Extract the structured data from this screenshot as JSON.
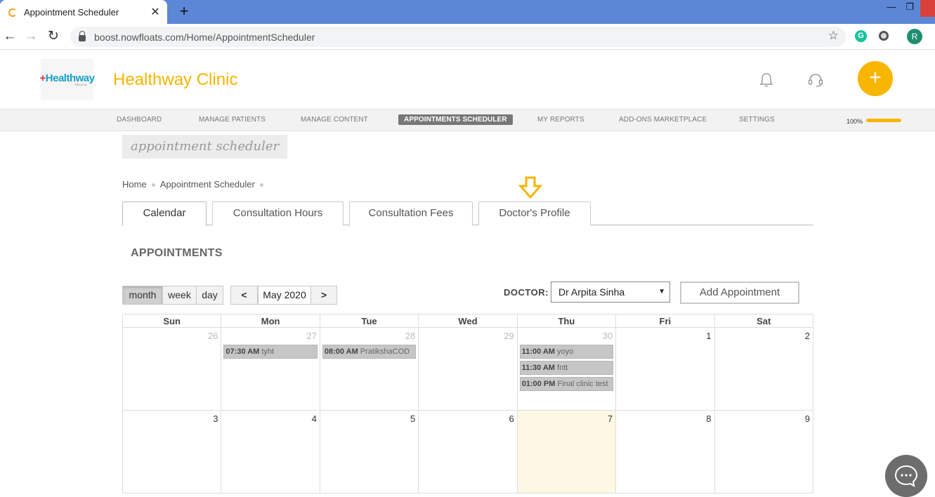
{
  "browser": {
    "tab_title": "Appointment Scheduler",
    "tab_close": "✕",
    "new_tab": "+",
    "url": "boost.nowfloats.com/Home/AppointmentScheduler",
    "avatar_letter": "R",
    "ext_letter": "G"
  },
  "header": {
    "logo_plus": "+",
    "logo_text": "Healthway",
    "logo_sub": "MEDICAL",
    "clinic_name": "Healthway Clinic",
    "fab_label": "+"
  },
  "nav": {
    "items": [
      "DASHBOARD",
      "MANAGE PATIENTS",
      "MANAGE CONTENT",
      "APPOINTMENTS SCHEDULER",
      "MY REPORTS",
      "ADD-ONS MARKETPLACE",
      "SETTINGS"
    ],
    "active_index": 3,
    "progress_label": "100%",
    "progress_value": 1.0
  },
  "page": {
    "title": "appointment scheduler",
    "breadcrumb": [
      "Home",
      "Appointment Scheduler"
    ],
    "tabs": [
      "Calendar",
      "Consultation Hours",
      "Consultation Fees",
      "Doctor's Profile"
    ],
    "section_title": "APPOINTMENTS"
  },
  "toolbar": {
    "views": [
      "month",
      "week",
      "day"
    ],
    "active_view": "month",
    "prev": "<",
    "next": ">",
    "current_range": "May 2020",
    "doctor_label": "DOCTOR:",
    "doctor_value": "Dr Arpita Sinha",
    "add_label": "Add Appointment"
  },
  "calendar": {
    "weekdays": [
      "Sun",
      "Mon",
      "Tue",
      "Wed",
      "Thu",
      "Fri",
      "Sat"
    ],
    "weeks": [
      [
        {
          "day": "26",
          "other": true,
          "events": []
        },
        {
          "day": "27",
          "other": true,
          "events": [
            {
              "time": "07:30 AM",
              "title": "tyht"
            }
          ]
        },
        {
          "day": "28",
          "other": true,
          "events": [
            {
              "time": "08:00 AM",
              "title": "PratikshaCOD"
            }
          ]
        },
        {
          "day": "29",
          "other": true,
          "events": []
        },
        {
          "day": "30",
          "other": true,
          "events": [
            {
              "time": "11:00 AM",
              "title": "yoyo"
            },
            {
              "time": "11:30 AM",
              "title": "fntt"
            },
            {
              "time": "01:00 PM",
              "title": "Final clinic test"
            }
          ]
        },
        {
          "day": "1",
          "other": false,
          "events": []
        },
        {
          "day": "2",
          "other": false,
          "events": []
        }
      ],
      [
        {
          "day": "3",
          "other": false,
          "events": []
        },
        {
          "day": "4",
          "other": false,
          "events": []
        },
        {
          "day": "5",
          "other": false,
          "events": []
        },
        {
          "day": "6",
          "other": false,
          "events": []
        },
        {
          "day": "7",
          "other": false,
          "today": true,
          "events": []
        },
        {
          "day": "8",
          "other": false,
          "events": []
        },
        {
          "day": "9",
          "other": false,
          "events": []
        }
      ]
    ]
  },
  "colors": {
    "brand": "#f5b400",
    "chrome_tabbar": "#5b87d6",
    "today_bg": "#fcf8e3"
  }
}
